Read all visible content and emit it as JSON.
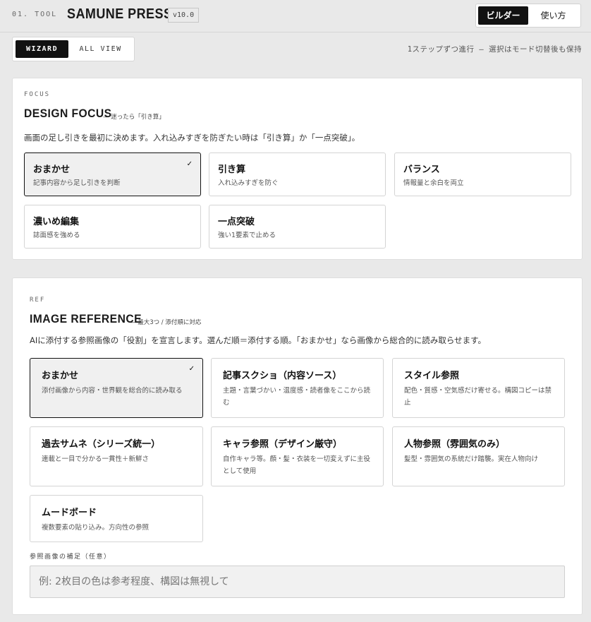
{
  "header": {
    "tool_tag": "01. TOOL",
    "brand": "SAMUNE PRESS",
    "version": "v10.0",
    "modes": [
      {
        "label": "ビルダー",
        "active": true
      },
      {
        "label": "使い方",
        "active": false
      }
    ]
  },
  "view_switch": {
    "wizard": "WIZARD",
    "all_view": "ALL VIEW",
    "active": "WIZARD"
  },
  "hint": "1ステップずつ進行 — 選択はモード切替後も保持",
  "focus": {
    "kicker": "FOCUS",
    "title": "DESIGN FOCUS",
    "note": "— 迷ったら「引き算」",
    "desc": "画面の足し引きを最初に決めます。入れ込みすぎを防ぎたい時は「引き算」か「一点突破」。",
    "options": [
      {
        "title": "おまかせ",
        "sub": "記事内容から足し引きを判断",
        "selected": true
      },
      {
        "title": "引き算",
        "sub": "入れ込みすぎを防ぐ",
        "selected": false
      },
      {
        "title": "バランス",
        "sub": "情報量と余白を両立",
        "selected": false
      },
      {
        "title": "濃いめ編集",
        "sub": "誌面感を強める",
        "selected": false
      },
      {
        "title": "一点突破",
        "sub": "強い1要素で止める",
        "selected": false
      }
    ]
  },
  "ref": {
    "kicker": "REF",
    "title": "IMAGE REFERENCE",
    "note": "— 最大3つ / 添付順に対応",
    "desc": "AIに添付する参照画像の「役割」を宣言します。選んだ順＝添付する順。「おまかせ」なら画像から総合的に読み取らせます。",
    "options": [
      {
        "title": "おまかせ",
        "sub": "添付画像から内容・世界観を総合的に読み取る",
        "selected": true
      },
      {
        "title": "記事スクショ（内容ソース）",
        "sub": "主題・言葉づかい・温度感・読者像をここから読む",
        "selected": false
      },
      {
        "title": "スタイル参照",
        "sub": "配色・質感・空気感だけ寄せる。構図コピーは禁止",
        "selected": false
      },
      {
        "title": "過去サムネ（シリーズ統一）",
        "sub": "連載と一目で分かる一貫性＋新鮮さ",
        "selected": false
      },
      {
        "title": "キャラ参照（デザイン厳守）",
        "sub": "自作キャラ等。顔・髪・衣装を一切変えずに主役として使用",
        "selected": false
      },
      {
        "title": "人物参照（雰囲気のみ）",
        "sub": "髪型・雰囲気の系統だけ踏襲。実在人物向け",
        "selected": false
      },
      {
        "title": "ムードボード",
        "sub": "複数要素の貼り込み。方向性の参照",
        "selected": false
      }
    ],
    "note_field": {
      "label": "参照画像の補足（任意）",
      "value": "",
      "placeholder": "例: 2枚目の色は参考程度、構図は無視して"
    }
  }
}
